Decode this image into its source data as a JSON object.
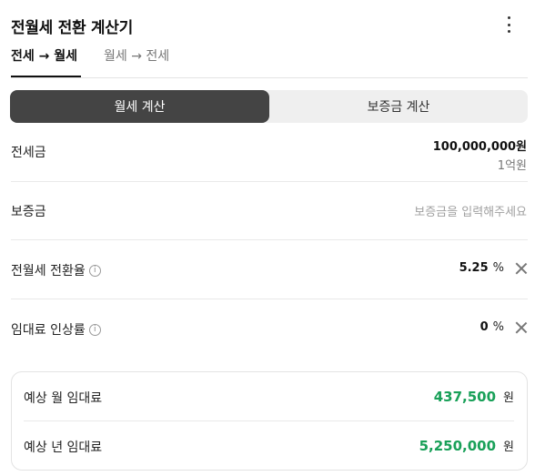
{
  "header": {
    "title": "전월세 전환 계산기"
  },
  "tabs": [
    {
      "label": "전세 → 월세"
    },
    {
      "label": "월세 → 전세"
    }
  ],
  "segment": {
    "on_label": "월세 계산",
    "off_label": "보증금 계산"
  },
  "rows": {
    "jeonse": {
      "label": "전세금",
      "value": "100,000,000원",
      "sub": "1억원"
    },
    "deposit": {
      "label": "보증금",
      "placeholder": "보증금을 입력해주세요"
    },
    "conversion_rate": {
      "label": "전월세 전환율",
      "value": "5.25",
      "unit": "%"
    },
    "rent_increase": {
      "label": "임대료 인상률",
      "value": "0",
      "unit": "%"
    }
  },
  "result": {
    "monthly": {
      "label": "예상 월 임대료",
      "value": "437,500",
      "unit": "원"
    },
    "yearly": {
      "label": "예상 년 임대료",
      "value": "5,250,000",
      "unit": "원"
    }
  },
  "colors": {
    "accent_green": "#18a058",
    "segment_active": "#444444"
  },
  "icons": {
    "menu": "more-vertical-icon",
    "info": "info-icon",
    "clear": "close-icon"
  }
}
